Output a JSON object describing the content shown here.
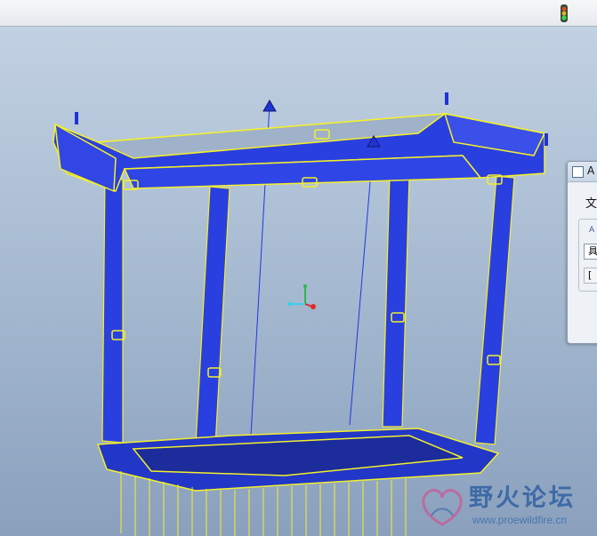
{
  "colors": {
    "mesh_fill": "#2a3fe0",
    "mesh_edges": "#f4f02a",
    "wire": "#2038e0",
    "background_top": "#c2d1e2",
    "background_bottom": "#8aa0bd"
  },
  "toolbar": {
    "status_icon": "traffic-light-icon"
  },
  "viewport": {
    "model": "3d-frame-mesh",
    "csys_icon": "coordinate-system-icon"
  },
  "dialog": {
    "title": "A",
    "menu_item": "文",
    "group_label": "A",
    "field1": "具",
    "field2": "["
  },
  "watermark": {
    "title": "野火论坛",
    "url": "www.proewildfire.cn"
  }
}
